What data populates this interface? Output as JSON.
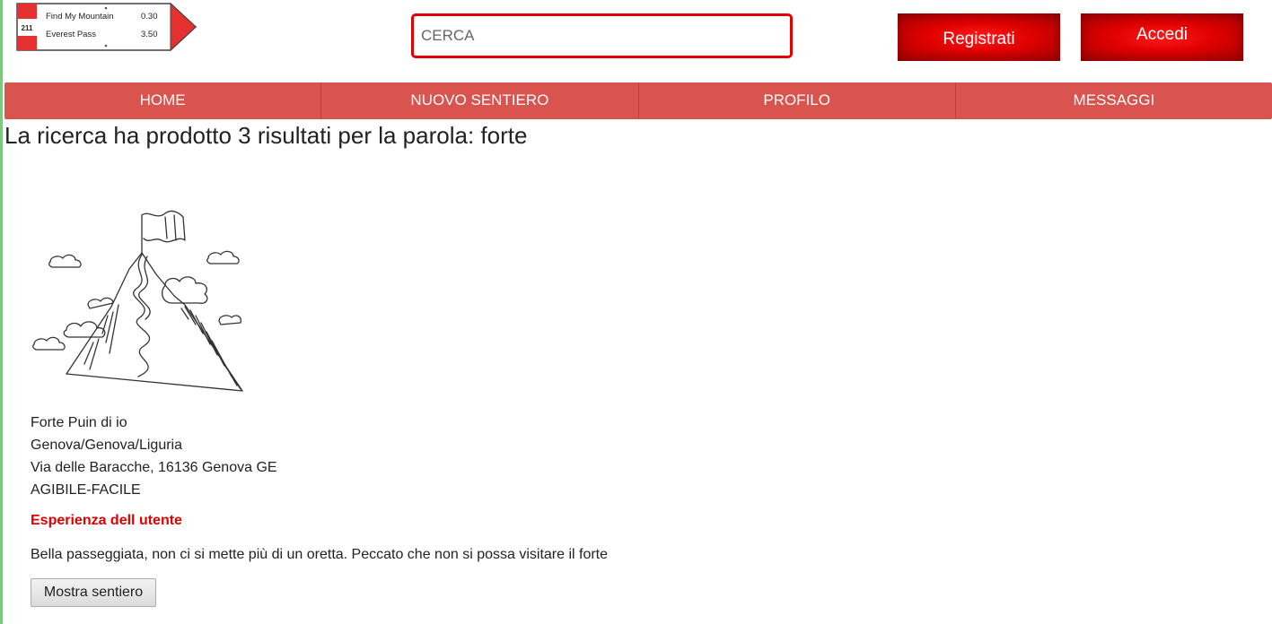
{
  "logo": {
    "number": "211",
    "rows": [
      {
        "label": "Find My Mountain",
        "value": "0.30"
      },
      {
        "label": "Everest Pass",
        "value": "3.50"
      }
    ]
  },
  "search": {
    "placeholder": "CERCA"
  },
  "auth": {
    "register_label": "Registrati",
    "login_label": "Accedi"
  },
  "nav": {
    "items": [
      {
        "label": "HOME"
      },
      {
        "label": "NUOVO SENTIERO"
      },
      {
        "label": "PROFILO"
      },
      {
        "label": "MESSAGGI"
      }
    ]
  },
  "results": {
    "summary": "La ricerca ha prodotto 3 risultati per la parola: forte",
    "items": [
      {
        "name": "Forte Puin di io",
        "location": "Genova/Genova/Liguria",
        "address": "Via delle Baracche, 16136 Genova GE",
        "difficulty": "AGIBILE-FACILE",
        "experience_title": "Esperienza dell utente",
        "experience_text": "Bella passeggiata, non ci si mette più di un oretta. Peccato che non si possa visitare il forte",
        "button_label": "Mostra sentiero"
      }
    ]
  },
  "colors": {
    "accent": "#e00000",
    "nav": "#d9534f"
  }
}
